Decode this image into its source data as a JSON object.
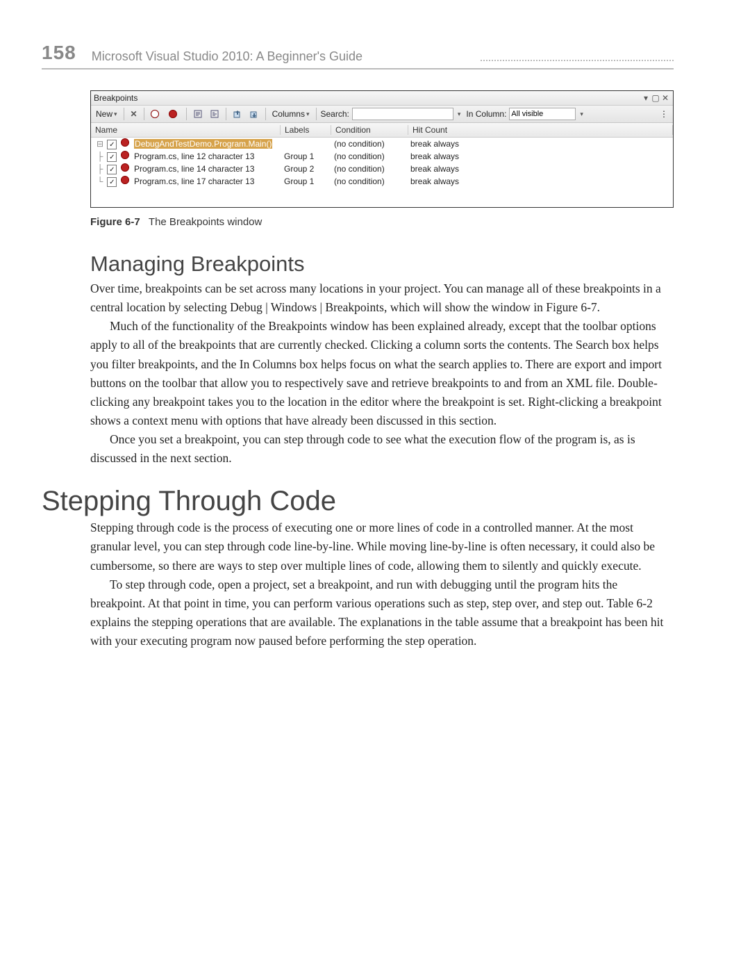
{
  "page_number": "158",
  "running_title": "Microsoft Visual Studio 2010: A Beginner's Guide",
  "figure": {
    "caption_label": "Figure 6-7",
    "caption_text": "The Breakpoints window",
    "window_title": "Breakpoints",
    "toolbar": {
      "new": "New",
      "columns": "Columns",
      "search_label": "Search:",
      "search_value": "",
      "in_column_label": "In Column:",
      "in_column_value": "All visible"
    },
    "headers": {
      "name": "Name",
      "labels": "Labels",
      "condition": "Condition",
      "hit": "Hit Count"
    },
    "rows": [
      {
        "selected": true,
        "name": "DebugAndTestDemo.Program.Main()",
        "labels": "",
        "cond": "(no condition)",
        "hit": "break always"
      },
      {
        "selected": false,
        "name": "Program.cs, line 12 character 13",
        "labels": "Group 1",
        "cond": "(no condition)",
        "hit": "break always"
      },
      {
        "selected": false,
        "name": "Program.cs, line 14 character 13",
        "labels": "Group 2",
        "cond": "(no condition)",
        "hit": "break always"
      },
      {
        "selected": false,
        "name": "Program.cs, line 17 character 13",
        "labels": "Group 1",
        "cond": "(no condition)",
        "hit": "break always"
      }
    ]
  },
  "heading_managing": "Managing Breakpoints",
  "para1": "Over time, breakpoints can be set across many locations in your project. You can manage all of these breakpoints in a central location by selecting Debug | Windows | Breakpoints, which will show the window in Figure 6-7.",
  "para2": "Much of the functionality of the Breakpoints window has been explained already, except that the toolbar options apply to all of the breakpoints that are currently checked. Clicking a column sorts the contents. The Search box helps you filter breakpoints, and the In Columns box helps focus on what the search applies to. There are export and import buttons on the toolbar that allow you to respectively save and retrieve breakpoints to and from an XML file. Double-clicking any breakpoint takes you to the location in the editor where the breakpoint is set. Right-clicking a breakpoint shows a context menu with options that have already been discussed in this section.",
  "para3": "Once you set a breakpoint, you can step through code to see what the execution flow of the program is, as is discussed in the next section.",
  "heading_stepping": "Stepping Through Code",
  "para4": "Stepping through code is the process of executing one or more lines of code in a controlled manner. At the most granular level, you can step through code line-by-line. While moving line-by-line is often necessary, it could also be cumbersome, so there are ways to step over multiple lines of code, allowing them to silently and quickly execute.",
  "para5": "To step through code, open a project, set a breakpoint, and run with debugging until the program hits the breakpoint. At that point in time, you can perform various operations such as step, step over, and step out. Table 6-2 explains the stepping operations that are available. The explanations in the table assume that a breakpoint has been hit with your executing program now paused before performing the step operation."
}
